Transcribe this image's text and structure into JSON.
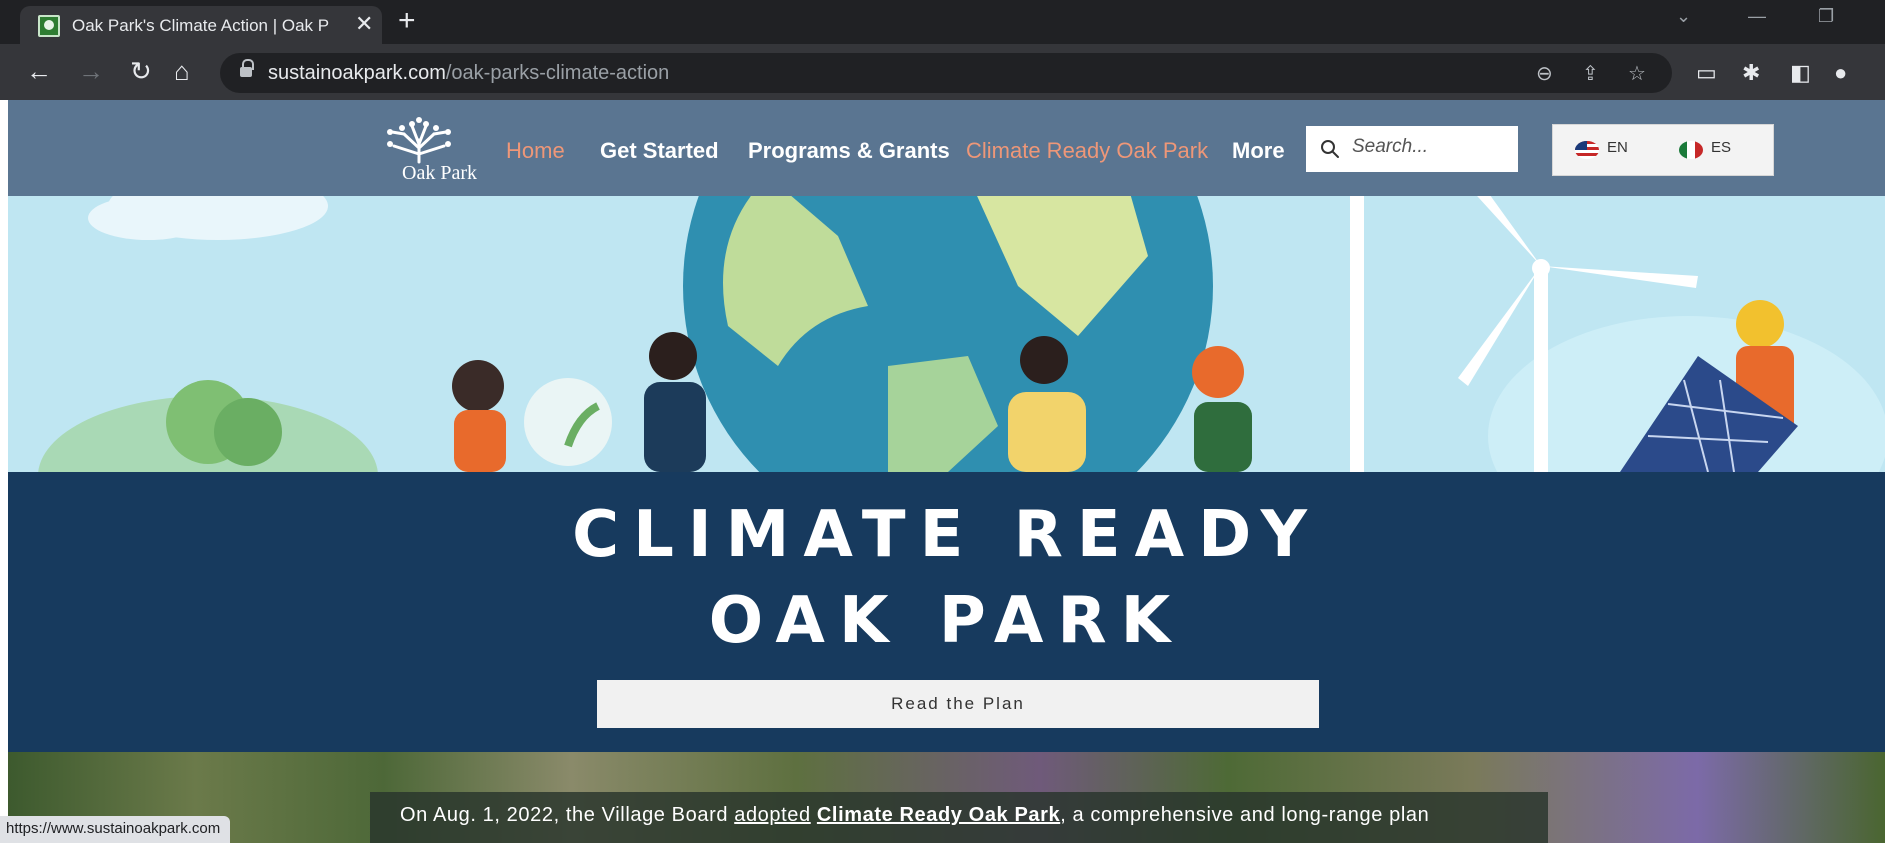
{
  "browser": {
    "tab_title": "Oak Park's Climate Action | Oak P",
    "url_domain": "sustainoakpark.com",
    "url_path": "/oak-parks-climate-action",
    "status_url": "https://www.sustainoakpark.com"
  },
  "site": {
    "logo_text": "Oak Park",
    "nav": {
      "home": "Home",
      "get_started": "Get Started",
      "programs": "Programs & Grants",
      "climate_ready": "Climate Ready Oak Park",
      "more": "More"
    },
    "search_placeholder": "Search...",
    "lang_en": "EN",
    "lang_es": "ES",
    "colors": {
      "header": "#5a7591",
      "band": "#173a5e",
      "nav_active": "#ee9778"
    }
  },
  "hero": {
    "title_line1": "CLIMATE READY",
    "title_line2": "OAK PARK",
    "button_label": "Read the Plan"
  },
  "intro": {
    "before": "On ",
    "date": "Aug. 1, 2022",
    "middle": ", the Village Board ",
    "adopted": "adopted",
    "space": " ",
    "plan_name": "Climate Ready Oak Park",
    "after": ", a comprehensive and long-range plan"
  }
}
